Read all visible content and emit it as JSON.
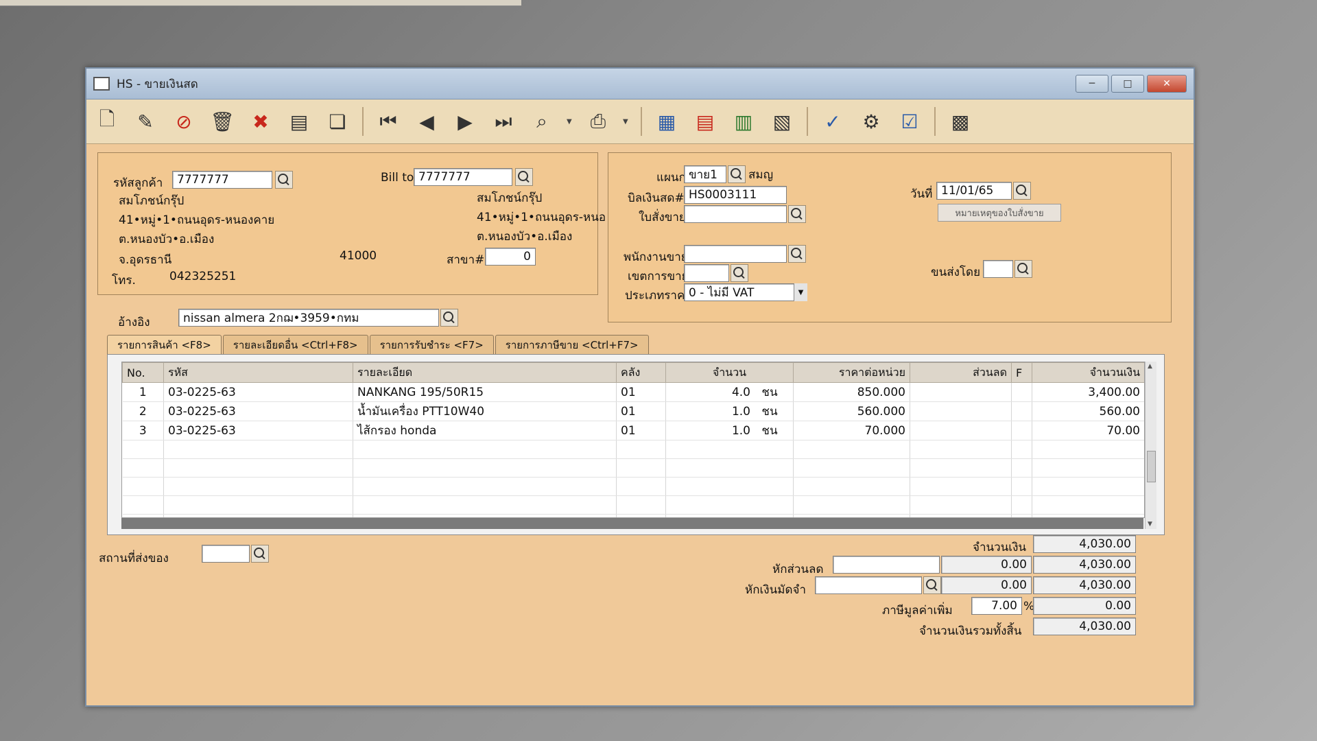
{
  "window": {
    "title": "HS - ขายเงินสด"
  },
  "customer": {
    "code_label": "รหัสลูกค้า",
    "code": "7777777",
    "name": "สมโภชน์กรุ๊ป",
    "address1": "41•หมู่•1•ถนนอุดร-หนองคาย",
    "address2": "ต.หนองบัว•อ.เมือง",
    "province": "จ.อุดรธานี",
    "postcode": "41000",
    "branch_label": "สาขา#",
    "branch": "0",
    "phone_label": "โทร.",
    "phone": "042325251",
    "ref_label": "อ้างอิง",
    "ref": "nissan almera 2กฌ•3959•กทม"
  },
  "bill_to": {
    "label": "Bill to",
    "code": "7777777",
    "name": "สมโภชน์กรุ๊ป",
    "address1": "41•หมู่•1•ถนนอุดร-หนอ",
    "address2": "ต.หนองบัว•อ.เมือง"
  },
  "doc": {
    "dept_label": "แผนก",
    "dept": "ขาย1",
    "dept_name": "สมญ",
    "bill_label": "บิลเงินสด#",
    "bill": "HS0003111",
    "order_label": "ใบสั่งขาย",
    "order": "",
    "date_label": "วันที่",
    "date": "11/01/65",
    "order_note_button": "หมายเหตุของใบสั่งขาย",
    "salesman_label": "พนักงานขาย",
    "salesman": "",
    "area_label": "เขตการขาย",
    "area": "",
    "ship_by_label": "ขนส่งโดย",
    "ship_by": "",
    "price_type_label": "ประเภทราคา",
    "price_type": "0 - ไม่มี VAT"
  },
  "tabs": [
    {
      "label": "รายการสินค้า <F8>"
    },
    {
      "label": "รายละเอียดอื่น <Ctrl+F8>"
    },
    {
      "label": "รายการรับชำระ <F7>"
    },
    {
      "label": "รายการภาษีขาย <Ctrl+F7>"
    }
  ],
  "grid": {
    "headers": [
      "No.",
      "รหัส",
      "รายละเอียด",
      "คลัง",
      "จำนวน",
      "ราคาต่อหน่วย",
      "ส่วนลด",
      "F",
      "จำนวนเงิน"
    ],
    "rows": [
      {
        "no": "1",
        "code": "03-0225-63",
        "desc": "NANKANG 195/50R15",
        "wh": "01",
        "qty": "4.0",
        "unit": "ชน",
        "price": "850.000",
        "disc": "",
        "f": "",
        "amount": "3,400.00"
      },
      {
        "no": "2",
        "code": "03-0225-63",
        "desc": "น้ำมันเครื่อง PTT10W40",
        "wh": "01",
        "qty": "1.0",
        "unit": "ชน",
        "price": "560.000",
        "disc": "",
        "f": "",
        "amount": "560.00"
      },
      {
        "no": "3",
        "code": "03-0225-63",
        "desc": "ไส้กรอง honda",
        "wh": "01",
        "qty": "1.0",
        "unit": "ชน",
        "price": "70.000",
        "disc": "",
        "f": "",
        "amount": "70.00"
      }
    ],
    "empty_rows": 6
  },
  "footer": {
    "ship_place_label": "สถานที่ส่งของ",
    "ship_place": "",
    "amount_label": "จำนวนเงิน",
    "amount": "4,030.00",
    "discount_label": "หักส่วนลด",
    "discount_input": "",
    "discount_value": "0.00",
    "discount_total": "4,030.00",
    "deposit_label": "หักเงินมัดจำ",
    "deposit_input": "",
    "deposit_value": "0.00",
    "deposit_total": "4,030.00",
    "vat_label": "ภาษีมูลค่าเพิ่ม",
    "vat_rate": "7.00",
    "vat_percent": "%",
    "vat_amount": "0.00",
    "grand_total_label": "จำนวนเงินรวมทั้งสิ้น",
    "grand_total": "4,030.00"
  }
}
